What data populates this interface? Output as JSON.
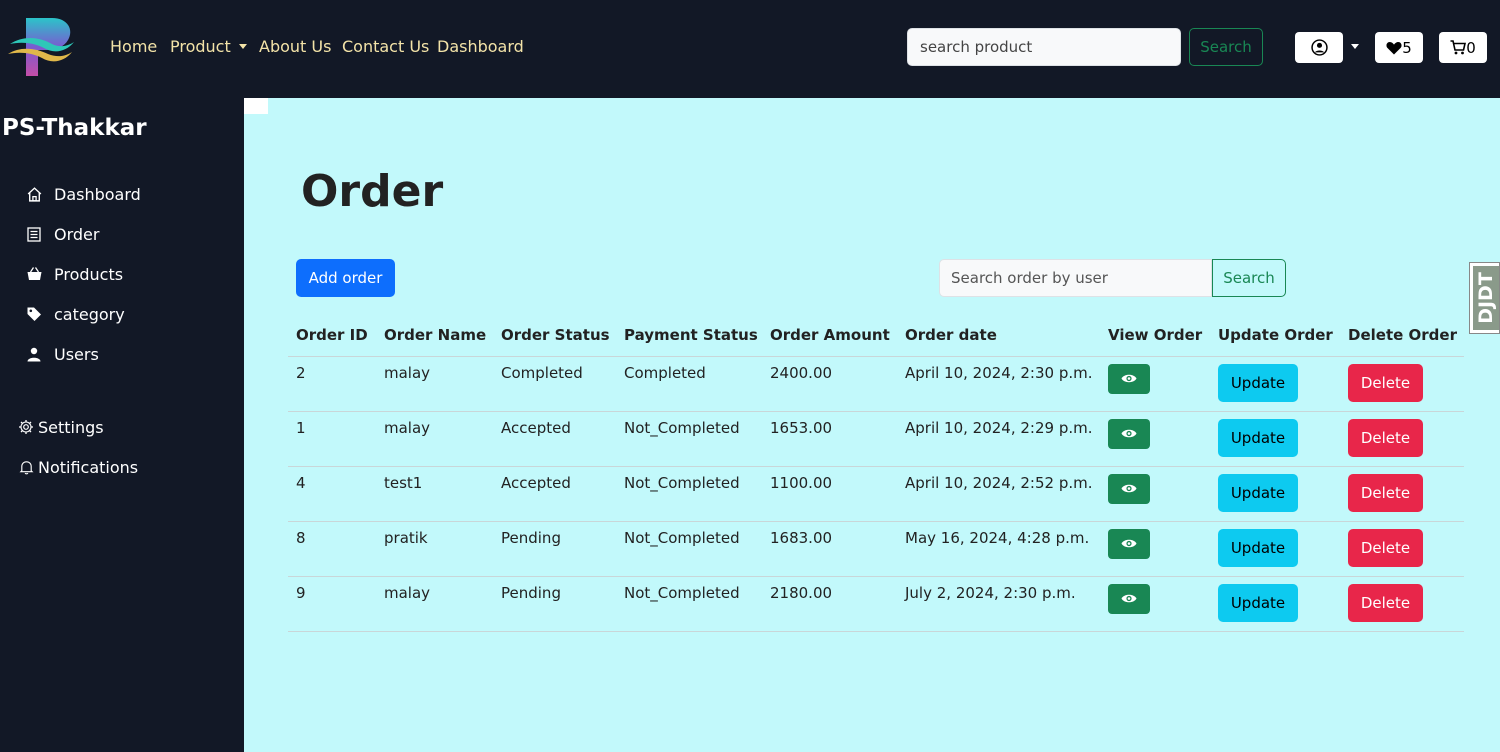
{
  "navbar": {
    "links": [
      "Home",
      "Product",
      "About Us",
      "Contact Us",
      "Dashboard"
    ],
    "search": {
      "placeholder": "search product",
      "button": "Search"
    },
    "wishlist_count": "5",
    "cart_count": "0"
  },
  "sidebar": {
    "brand": "PS-Thakkar",
    "items": [
      {
        "label": "Dashboard",
        "icon": "home-icon"
      },
      {
        "label": "Order",
        "icon": "receipt-icon"
      },
      {
        "label": "Products",
        "icon": "basket-icon"
      },
      {
        "label": "category",
        "icon": "tag-icon"
      },
      {
        "label": "Users",
        "icon": "person-icon"
      }
    ],
    "settings": "Settings",
    "notifications": "Notifications"
  },
  "main": {
    "title": "Order",
    "add_button": "Add order",
    "search": {
      "placeholder": "Search order by user",
      "button": "Search"
    },
    "columns": [
      "Order ID",
      "Order Name",
      "Order Status",
      "Payment Status",
      "Order Amount",
      "Order date",
      "View Order",
      "Update Order",
      "Delete Order"
    ],
    "rows": [
      {
        "id": "2",
        "name": "malay",
        "status": "Completed",
        "payment": "Completed",
        "amount": "2400.00",
        "date": "April 10, 2024, 2:30 p.m."
      },
      {
        "id": "1",
        "name": "malay",
        "status": "Accepted",
        "payment": "Not_Completed",
        "amount": "1653.00",
        "date": "April 10, 2024, 2:29 p.m."
      },
      {
        "id": "4",
        "name": "test1",
        "status": "Accepted",
        "payment": "Not_Completed",
        "amount": "1100.00",
        "date": "April 10, 2024, 2:52 p.m."
      },
      {
        "id": "8",
        "name": "pratik",
        "status": "Pending",
        "payment": "Not_Completed",
        "amount": "1683.00",
        "date": "May 16, 2024, 4:28 p.m."
      },
      {
        "id": "9",
        "name": "malay",
        "status": "Pending",
        "payment": "Not_Completed",
        "amount": "2180.00",
        "date": "July 2, 2024, 2:30 p.m."
      }
    ],
    "update_label": "Update",
    "delete_label": "Delete"
  },
  "debug_toolbar": "DJDT",
  "colors": {
    "background_dark": "#121826",
    "main_bg": "#c2f9fb",
    "nav_text": "#f3e3a8",
    "primary": "#0d6efd",
    "success": "#198754",
    "info": "#0dcaf0",
    "danger": "#e8264a"
  }
}
